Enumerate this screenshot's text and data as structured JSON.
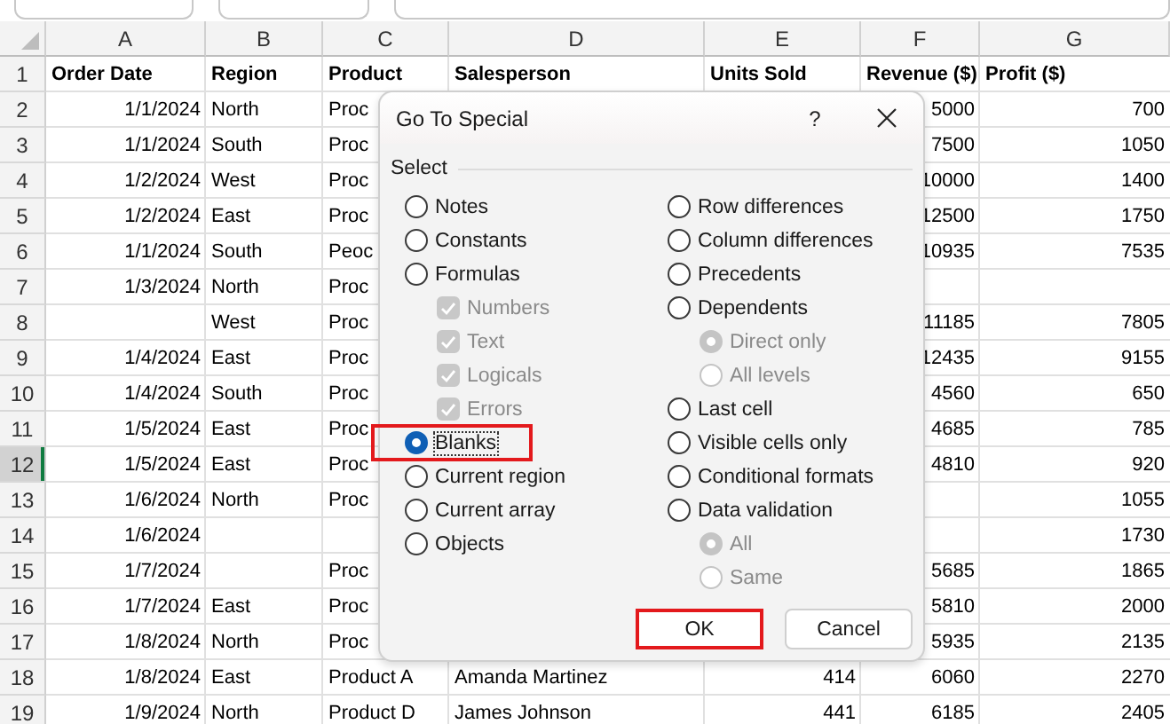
{
  "columns": [
    "A",
    "B",
    "C",
    "D",
    "E",
    "F",
    "G"
  ],
  "rows": [
    {
      "number": "1",
      "kind": "header",
      "selected": false,
      "cells": [
        "Order Date",
        "Region",
        "Product",
        "Salesperson",
        "Units Sold",
        "Revenue ($)",
        "Profit ($)"
      ]
    },
    {
      "number": "2",
      "kind": "data",
      "selected": false,
      "cells": [
        "1/1/2024",
        "North",
        "Proc",
        null,
        null,
        "5000",
        "700"
      ]
    },
    {
      "number": "3",
      "kind": "data",
      "selected": false,
      "cells": [
        "1/1/2024",
        "South",
        "Proc",
        null,
        null,
        "7500",
        "1050"
      ]
    },
    {
      "number": "4",
      "kind": "data",
      "selected": false,
      "cells": [
        "1/2/2024",
        "West",
        "Proc",
        null,
        null,
        "10000",
        "1400"
      ]
    },
    {
      "number": "5",
      "kind": "data",
      "selected": false,
      "cells": [
        "1/2/2024",
        "East",
        "Proc",
        null,
        null,
        "12500",
        "1750"
      ]
    },
    {
      "number": "6",
      "kind": "data",
      "selected": false,
      "cells": [
        "1/1/2024",
        "South",
        "Peoc",
        null,
        null,
        "10935",
        "7535"
      ]
    },
    {
      "number": "7",
      "kind": "data",
      "selected": false,
      "cells": [
        "1/3/2024",
        "North",
        "Proc",
        null,
        null,
        null,
        null
      ]
    },
    {
      "number": "8",
      "kind": "data",
      "selected": false,
      "cells": [
        null,
        "West",
        "Proc",
        null,
        null,
        "11185",
        "7805"
      ]
    },
    {
      "number": "9",
      "kind": "data",
      "selected": false,
      "cells": [
        "1/4/2024",
        "East",
        "Proc",
        null,
        null,
        "12435",
        "9155"
      ]
    },
    {
      "number": "10",
      "kind": "data",
      "selected": false,
      "cells": [
        "1/4/2024",
        "South",
        "Proc",
        null,
        null,
        "4560",
        "650"
      ]
    },
    {
      "number": "11",
      "kind": "data",
      "selected": false,
      "cells": [
        "1/5/2024",
        "East",
        "Proc",
        null,
        null,
        "4685",
        "785"
      ]
    },
    {
      "number": "12",
      "kind": "data",
      "selected": true,
      "cells": [
        "1/5/2024",
        "East",
        "Proc",
        null,
        null,
        "4810",
        "920"
      ]
    },
    {
      "number": "13",
      "kind": "data",
      "selected": false,
      "cells": [
        "1/6/2024",
        "North",
        "Proc",
        null,
        null,
        null,
        "1055"
      ]
    },
    {
      "number": "14",
      "kind": "data",
      "selected": false,
      "cells": [
        "1/6/2024",
        null,
        null,
        null,
        null,
        null,
        "1730"
      ]
    },
    {
      "number": "15",
      "kind": "data",
      "selected": false,
      "cells": [
        "1/7/2024",
        null,
        "Proc",
        null,
        null,
        "5685",
        "1865"
      ]
    },
    {
      "number": "16",
      "kind": "data",
      "selected": false,
      "cells": [
        "1/7/2024",
        "East",
        "Proc",
        null,
        null,
        "5810",
        "2000"
      ]
    },
    {
      "number": "17",
      "kind": "data",
      "selected": false,
      "cells": [
        "1/8/2024",
        "North",
        "Proc",
        null,
        null,
        "5935",
        "2135"
      ]
    },
    {
      "number": "18",
      "kind": "data",
      "selected": false,
      "cells": [
        "1/8/2024",
        "East",
        "Product A",
        "Amanda Martinez",
        "414",
        "6060",
        "2270"
      ]
    },
    {
      "number": "19",
      "kind": "data",
      "selected": false,
      "cells": [
        "1/9/2024",
        "North",
        "Product D",
        "James Johnson",
        "441",
        "6185",
        "2405"
      ]
    }
  ],
  "dialog": {
    "title": "Go To Special",
    "help": "?",
    "group_label": "Select",
    "option_columns": [
      [
        {
          "kind": "radio",
          "label": "Notes",
          "selected": false,
          "disabled": false,
          "highlighted": false
        },
        {
          "kind": "radio",
          "label": "Constants",
          "selected": false,
          "disabled": false,
          "highlighted": false
        },
        {
          "kind": "radio",
          "label": "Formulas",
          "selected": false,
          "disabled": false,
          "highlighted": false,
          "children": [
            {
              "kind": "checkbox",
              "label": "Numbers",
              "checked": true,
              "disabled": true
            },
            {
              "kind": "checkbox",
              "label": "Text",
              "checked": true,
              "disabled": true
            },
            {
              "kind": "checkbox",
              "label": "Logicals",
              "checked": true,
              "disabled": true
            },
            {
              "kind": "checkbox",
              "label": "Errors",
              "checked": true,
              "disabled": true
            }
          ]
        },
        {
          "kind": "radio",
          "label": "Blanks",
          "selected": true,
          "disabled": false,
          "highlighted": true
        },
        {
          "kind": "radio",
          "label": "Current region",
          "selected": false,
          "disabled": false,
          "highlighted": false
        },
        {
          "kind": "radio",
          "label": "Current array",
          "selected": false,
          "disabled": false,
          "highlighted": false
        },
        {
          "kind": "radio",
          "label": "Objects",
          "selected": false,
          "disabled": false,
          "highlighted": false
        }
      ],
      [
        {
          "kind": "radio",
          "label": "Row differences",
          "selected": false,
          "disabled": false,
          "highlighted": false
        },
        {
          "kind": "radio",
          "label": "Column differences",
          "selected": false,
          "disabled": false,
          "highlighted": false
        },
        {
          "kind": "radio",
          "label": "Precedents",
          "selected": false,
          "disabled": false,
          "highlighted": false
        },
        {
          "kind": "radio",
          "label": "Dependents",
          "selected": false,
          "disabled": false,
          "highlighted": false,
          "children": [
            {
              "kind": "radio",
              "label": "Direct only",
              "selected": true,
              "disabled": true
            },
            {
              "kind": "radio",
              "label": "All levels",
              "selected": false,
              "disabled": true
            }
          ]
        },
        {
          "kind": "radio",
          "label": "Last cell",
          "selected": false,
          "disabled": false,
          "highlighted": false
        },
        {
          "kind": "radio",
          "label": "Visible cells only",
          "selected": false,
          "disabled": false,
          "highlighted": false
        },
        {
          "kind": "radio",
          "label": "Conditional formats",
          "selected": false,
          "disabled": false,
          "highlighted": false
        },
        {
          "kind": "radio",
          "label": "Data validation",
          "selected": false,
          "disabled": false,
          "highlighted": false,
          "children": [
            {
              "kind": "radio",
              "label": "All",
              "selected": true,
              "disabled": true
            },
            {
              "kind": "radio",
              "label": "Same",
              "selected": false,
              "disabled": true
            }
          ]
        }
      ]
    ],
    "buttons": [
      {
        "label": "OK",
        "highlighted": true
      },
      {
        "label": "Cancel",
        "highlighted": false
      }
    ]
  }
}
